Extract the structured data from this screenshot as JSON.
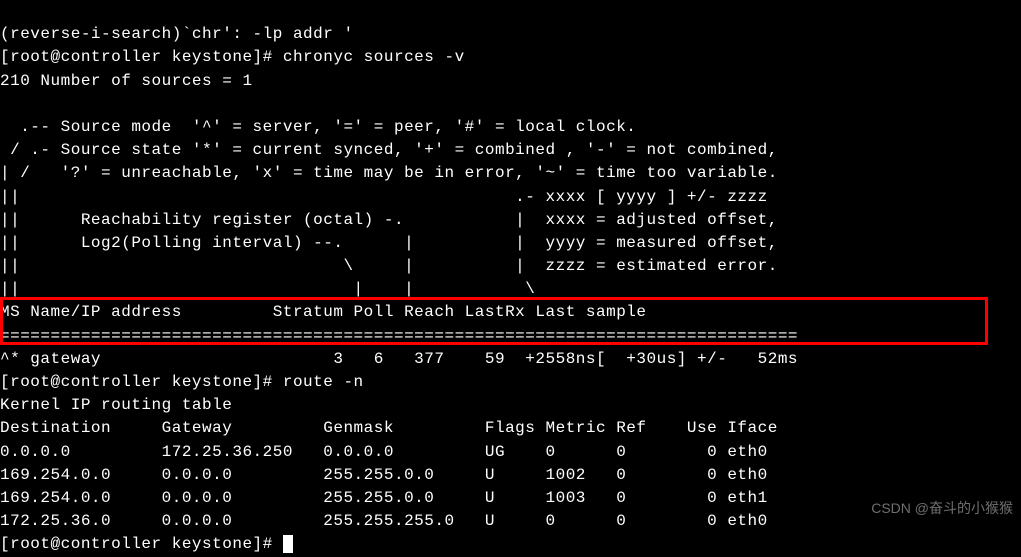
{
  "lines": {
    "l0": "(reverse-i-search)`chr': -lp addr '",
    "l1": "[root@controller keystone]# chronyc sources -v",
    "l2": "210 Number of sources = 1",
    "l3": "",
    "l4": "  .-- Source mode  '^' = server, '=' = peer, '#' = local clock.",
    "l5": " / .- Source state '*' = current synced, '+' = combined , '-' = not combined,",
    "l6": "| /   '?' = unreachable, 'x' = time may be in error, '~' = time too variable.",
    "l7": "||                                                 .- xxxx [ yyyy ] +/- zzzz",
    "l8": "||      Reachability register (octal) -.           |  xxxx = adjusted offset,",
    "l9": "||      Log2(Polling interval) --.      |          |  yyyy = measured offset,",
    "l10": "||                                \\     |          |  zzzz = estimated error.",
    "l11": "||                                 |    |           \\",
    "l12": "MS Name/IP address         Stratum Poll Reach LastRx Last sample",
    "l13": "===============================================================================",
    "l14": "^* gateway                       3   6   377    59  +2558ns[  +30us] +/-   52ms",
    "l15": "[root@controller keystone]# route -n",
    "l16": "Kernel IP routing table",
    "l17": "Destination     Gateway         Genmask         Flags Metric Ref    Use Iface",
    "l18": "0.0.0.0         172.25.36.250   0.0.0.0         UG    0      0        0 eth0",
    "l19": "169.254.0.0     0.0.0.0         255.255.0.0     U     1002   0        0 eth0",
    "l20": "169.254.0.0     0.0.0.0         255.255.0.0     U     1003   0        0 eth1",
    "l21": "172.25.36.0     0.0.0.0         255.255.255.0   U     0      0        0 eth0",
    "l22": "[root@controller keystone]# "
  },
  "watermark": "CSDN @奋斗的小猴猴"
}
